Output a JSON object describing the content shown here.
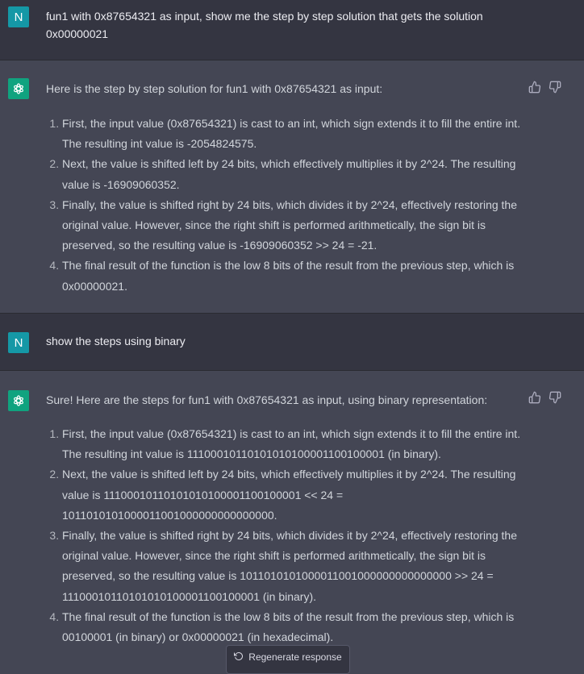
{
  "conversation": {
    "user_initial": "N",
    "message1": {
      "text_line1": "fun1 with 0x87654321 as input, show me the step by step solution that gets the solution",
      "text_line2": "0x00000021"
    },
    "reply1": {
      "intro": "Here is the step by step solution for fun1 with 0x87654321 as input:",
      "steps": [
        "First, the input value (0x87654321) is cast to an int, which sign extends it to fill the entire int. The resulting int value is -2054824575.",
        "Next, the value is shifted left by 24 bits, which effectively multiplies it by 2^24. The resulting value is -16909060352.",
        "Finally, the value is shifted right by 24 bits, which divides it by 2^24, effectively restoring the original value. However, since the right shift is performed arithmetically, the sign bit is preserved, so the resulting value is -16909060352 >> 24 = -21.",
        "The final result of the function is the low 8 bits of the result from the previous step, which is 0x00000021."
      ]
    },
    "message2": {
      "text": "show the steps using binary"
    },
    "reply2": {
      "intro": "Sure! Here are the steps for fun1 with 0x87654321 as input, using binary representation:",
      "steps": [
        "First, the input value (0x87654321) is cast to an int, which sign extends it to fill the entire int. The resulting int value is 11100010110101010100001100100001 (in binary).",
        "Next, the value is shifted left by 24 bits, which effectively multiplies it by 2^24. The resulting value is 11100010110101010100001100100001 << 24 = 1011010101000011001000000000000000.",
        "Finally, the value is shifted right by 24 bits, which divides it by 2^24, effectively restoring the original value. However, since the right shift is performed arithmetically, the sign bit is preserved, so the resulting value is 1011010101000011001000000000000000 >> 24 = 11100010110101010100001100100001 (in binary).",
        "The final result of the function is the low 8 bits of the result from the previous step, which is 00100001 (in binary) or 0x00000021 (in hexadecimal)."
      ]
    }
  },
  "regenerate_label": "Regenerate response",
  "icons": {
    "assistant": "openai-logo-icon",
    "thumbs_up": "thumbs-up-icon",
    "thumbs_down": "thumbs-down-icon",
    "regenerate": "refresh-icon"
  },
  "colors": {
    "user_bg": "#343541",
    "assistant_bg": "#444654",
    "user_avatar": "#1598a6",
    "assistant_avatar": "#10a37f"
  }
}
